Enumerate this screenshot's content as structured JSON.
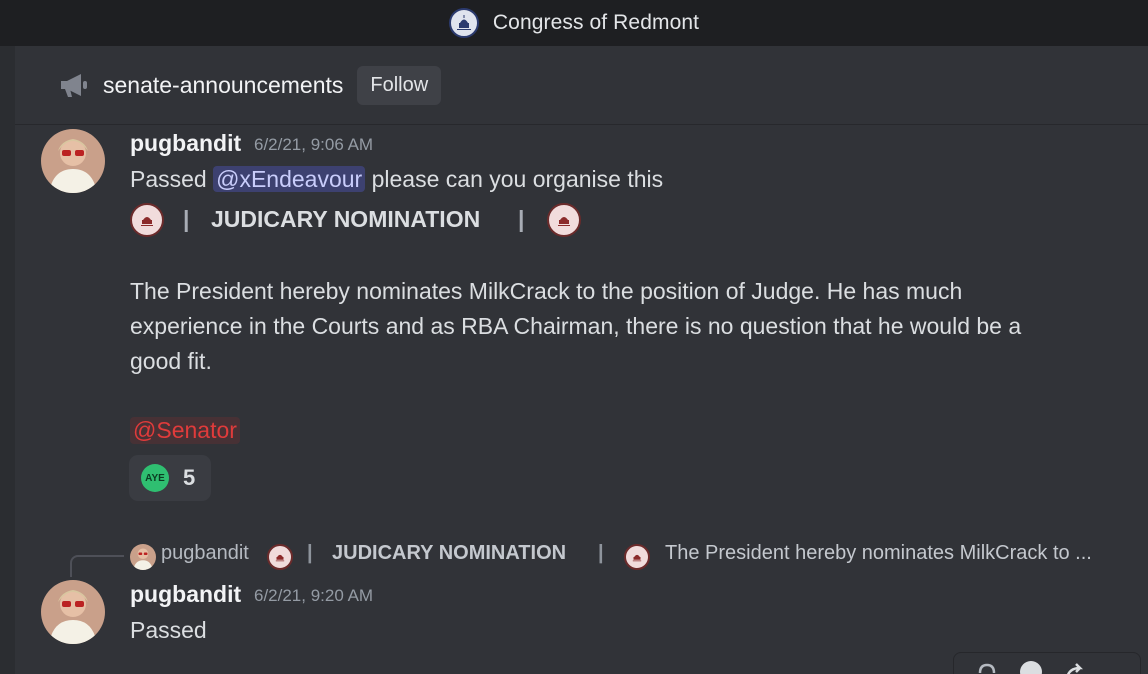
{
  "window": {
    "title": "Congress of Redmont"
  },
  "channel": {
    "name": "senate-announcements",
    "follow_label": "Follow"
  },
  "messages": [
    {
      "author": "pugbandit",
      "timestamp": "6/2/21, 9:06 AM",
      "text_before": "Passed",
      "mention": "@xEndeavour",
      "text_after": "please can you organise this",
      "embed_title": "JUDICARY NOMINATION",
      "pipe": "|",
      "body_lines": [
        "The President hereby nominates MilkCrack to the position of Judge. He has much",
        "experience in the Courts and as RBA Chairman, there is no question that he would be a",
        "good fit."
      ],
      "role_mention": "@Senator",
      "reaction": {
        "emoji": "AYE",
        "count": "5"
      }
    },
    {
      "reply": {
        "author": "pugbandit",
        "title": "JUDICARY NOMINATION",
        "preview": "The President hereby nominates MilkCrack to ..."
      },
      "author": "pugbandit",
      "timestamp": "6/2/21, 9:20 AM",
      "text": "Passed"
    }
  ],
  "colors": {
    "background": "#313338",
    "titlebar": "#1e1f22",
    "mention_text": "#c9cdfb",
    "role_mention": "#e03b3b",
    "aye_badge": "#2fbf71"
  },
  "icons": {
    "server": "capitol-dome-icon",
    "channel": "megaphone-icon",
    "seal": "senate-seal-icon",
    "reaction": "aye-emoji-icon",
    "toolbar": [
      "reply-icon",
      "emoji-icon",
      "forward-icon"
    ]
  }
}
